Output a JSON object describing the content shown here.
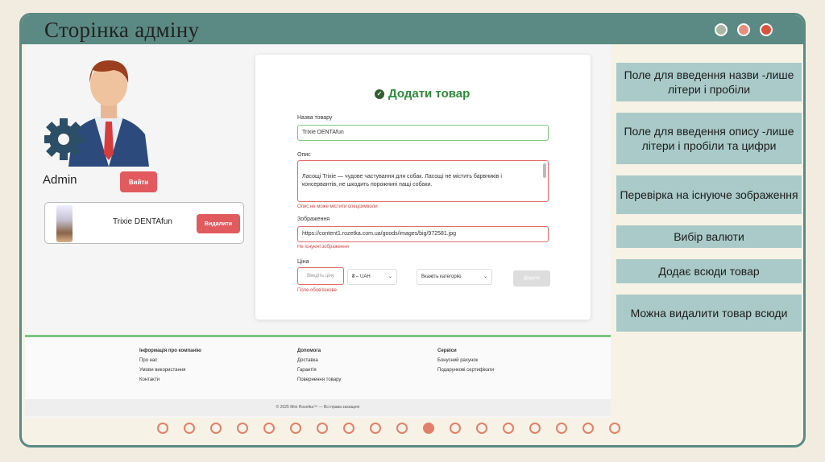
{
  "slide": {
    "title": "Сторінка адміну",
    "window_dots": [
      {
        "name": "dot-gray",
        "color": "#a9b7a4"
      },
      {
        "name": "dot-pink",
        "color": "#e6907d"
      },
      {
        "name": "dot-red",
        "color": "#d9533d"
      }
    ],
    "accent_color": "#5b8a84"
  },
  "admin": {
    "label": "Admin",
    "logout_label": "Вийти"
  },
  "product_card": {
    "name": "Trixie DENTAfun",
    "delete_label": "Видалити"
  },
  "form": {
    "title": "Додати товар",
    "name_label": "Назва товару",
    "name_value": "Trixie DENTAfun",
    "desc_label": "Опис",
    "desc_value": "Ласощі Trixie — чудове частування для собак. Ласощі не містить барвників і консервантів, не шкодить порожнині пащі собаки.",
    "desc_error": "Опис не може містити спецсимволи",
    "image_label": "Зображення",
    "image_value": "https://content1.rozetka.com.ua/goods/images/big/972581.jpg",
    "image_error": "Не існуючі зображення",
    "price_label": "Ціна",
    "price_placeholder": "Введіть ціну",
    "price_error": "Поле обов'язкове",
    "currency_value": "₴ – UAH",
    "category_placeholder": "Вкажіть категорію",
    "submit_label": "Додати"
  },
  "footer": {
    "col1": {
      "heading": "Інформація про компанію",
      "items": [
        "Про нас",
        "Умови використання",
        "Контакти"
      ]
    },
    "col2": {
      "heading": "Допомога",
      "items": [
        "Доставка",
        "Гарантія",
        "Повернення товару"
      ]
    },
    "col3": {
      "heading": "Сервіси",
      "items": [
        "Бонусний рахунок",
        "Подарункові сертифікати"
      ]
    },
    "copyright": "© 2025 Mini Rozetka™ — Всі права захищені"
  },
  "notes": [
    "Поле для введення назви -лише літери і пробіли",
    "Поле для введення опису -лише літери і пробіли та цифри",
    "Перевірка на існуюче зображення",
    "Вибір валюти",
    "Додає всюди товар",
    "Можна видалити товар всюди"
  ],
  "pager": {
    "total": 18,
    "current": 11,
    "color": "#e0806a"
  }
}
